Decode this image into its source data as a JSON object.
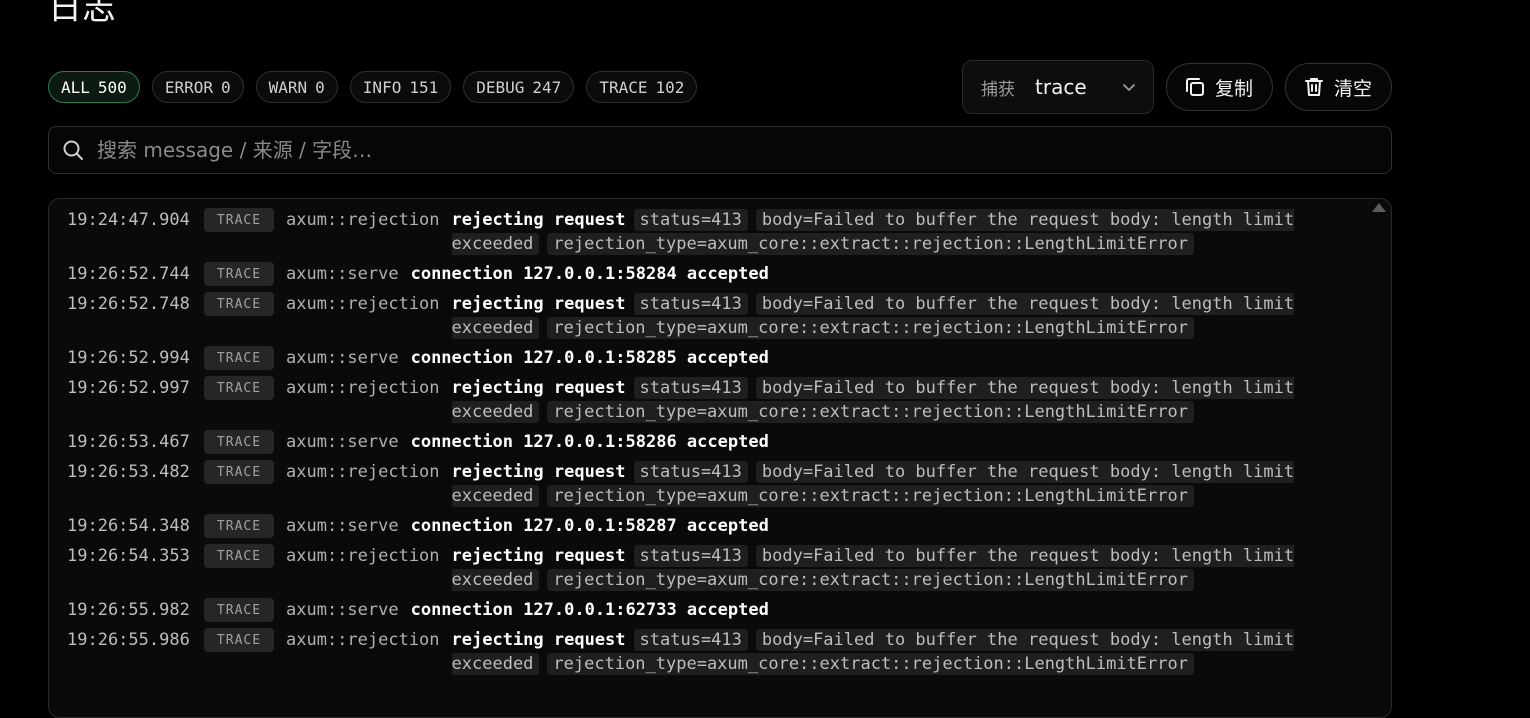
{
  "page": {
    "title": "日志"
  },
  "filters": [
    {
      "label": "ALL",
      "count": "500",
      "active": true
    },
    {
      "label": "ERROR",
      "count": "0",
      "active": false
    },
    {
      "label": "WARN",
      "count": "0",
      "active": false
    },
    {
      "label": "INFO",
      "count": "151",
      "active": false
    },
    {
      "label": "DEBUG",
      "count": "247",
      "active": false
    },
    {
      "label": "TRACE",
      "count": "102",
      "active": false
    }
  ],
  "capture": {
    "label": "捕获",
    "value": "trace"
  },
  "toolbar": {
    "copy_label": "复制",
    "clear_label": "清空"
  },
  "search": {
    "placeholder": "搜索 message / 来源 / 字段…"
  },
  "logs": [
    {
      "time": "19:24:47.904",
      "level": "TRACE",
      "source": "axum::rejection",
      "message": "rejecting request",
      "fields": [
        "status=413",
        "body=Failed to buffer the request body: length limit exceeded",
        "rejection_type=axum_core::extract::rejection::LengthLimitError"
      ]
    },
    {
      "time": "19:26:52.744",
      "level": "TRACE",
      "source": "axum::serve",
      "message": "connection 127.0.0.1:58284 accepted",
      "fields": []
    },
    {
      "time": "19:26:52.748",
      "level": "TRACE",
      "source": "axum::rejection",
      "message": "rejecting request",
      "fields": [
        "status=413",
        "body=Failed to buffer the request body: length limit exceeded",
        "rejection_type=axum_core::extract::rejection::LengthLimitError"
      ]
    },
    {
      "time": "19:26:52.994",
      "level": "TRACE",
      "source": "axum::serve",
      "message": "connection 127.0.0.1:58285 accepted",
      "fields": []
    },
    {
      "time": "19:26:52.997",
      "level": "TRACE",
      "source": "axum::rejection",
      "message": "rejecting request",
      "fields": [
        "status=413",
        "body=Failed to buffer the request body: length limit exceeded",
        "rejection_type=axum_core::extract::rejection::LengthLimitError"
      ]
    },
    {
      "time": "19:26:53.467",
      "level": "TRACE",
      "source": "axum::serve",
      "message": "connection 127.0.0.1:58286 accepted",
      "fields": []
    },
    {
      "time": "19:26:53.482",
      "level": "TRACE",
      "source": "axum::rejection",
      "message": "rejecting request",
      "fields": [
        "status=413",
        "body=Failed to buffer the request body: length limit exceeded",
        "rejection_type=axum_core::extract::rejection::LengthLimitError"
      ]
    },
    {
      "time": "19:26:54.348",
      "level": "TRACE",
      "source": "axum::serve",
      "message": "connection 127.0.0.1:58287 accepted",
      "fields": []
    },
    {
      "time": "19:26:54.353",
      "level": "TRACE",
      "source": "axum::rejection",
      "message": "rejecting request",
      "fields": [
        "status=413",
        "body=Failed to buffer the request body: length limit exceeded",
        "rejection_type=axum_core::extract::rejection::LengthLimitError"
      ]
    },
    {
      "time": "19:26:55.982",
      "level": "TRACE",
      "source": "axum::serve",
      "message": "connection 127.0.0.1:62733 accepted",
      "fields": []
    },
    {
      "time": "19:26:55.986",
      "level": "TRACE",
      "source": "axum::rejection",
      "message": "rejecting request",
      "fields": [
        "status=413",
        "body=Failed to buffer the request body: length limit exceeded",
        "rejection_type=axum_core::extract::rejection::LengthLimitError"
      ]
    }
  ],
  "colors": {
    "background": "#000000",
    "active_chip_border": "#2d7a4f",
    "active_chip_bg": "#0c1a12",
    "level_badge_bg": "#262626",
    "field_bg": "#1f1f1f"
  },
  "icons": {
    "search": "search-icon",
    "copy": "copy-icon",
    "clear": "trash-icon",
    "select": "chevron-down-icon"
  }
}
